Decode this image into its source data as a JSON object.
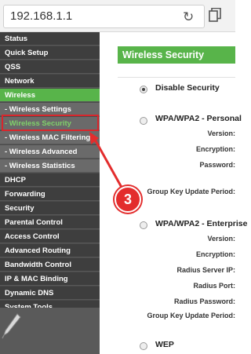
{
  "browser": {
    "url": "192.168.1.1",
    "reload_icon": "reload-icon",
    "tabs_icon": "tabs-icon"
  },
  "sidebar": {
    "items": [
      {
        "label": "Status"
      },
      {
        "label": "Quick Setup"
      },
      {
        "label": "QSS"
      },
      {
        "label": "Network"
      },
      {
        "label": "Wireless"
      },
      {
        "label": "- Wireless Settings"
      },
      {
        "label": "- Wireless Security"
      },
      {
        "label": "- Wireless MAC Filtering"
      },
      {
        "label": "- Wireless Advanced"
      },
      {
        "label": "- Wireless Statistics"
      },
      {
        "label": "DHCP"
      },
      {
        "label": "Forwarding"
      },
      {
        "label": "Security"
      },
      {
        "label": "Parental Control"
      },
      {
        "label": "Access Control"
      },
      {
        "label": "Advanced Routing"
      },
      {
        "label": "Bandwidth Control"
      },
      {
        "label": "IP & MAC Binding"
      },
      {
        "label": "Dynamic DNS"
      },
      {
        "label": "System Tools"
      }
    ]
  },
  "annotation": {
    "step_number": "3",
    "color": "#e32d2d"
  },
  "main": {
    "header": "Wireless Security",
    "options": [
      {
        "label": "Disable Security",
        "selected": true
      },
      {
        "label": "WPA/WPA2 - Personal",
        "selected": false,
        "fields": [
          "Version:",
          "Encryption:",
          "Password:",
          "Group Key Update Period:"
        ]
      },
      {
        "label": "WPA/WPA2 - Enterprise",
        "selected": false,
        "fields": [
          "Version:",
          "Encryption:",
          "Radius Server IP:",
          "Radius Port:",
          "Radius Password:",
          "Group Key Update Period:"
        ]
      },
      {
        "label": "WEP",
        "selected": false
      }
    ]
  },
  "colors": {
    "accent_green": "#58b44a",
    "sidebar_bg": "#3e3e3e",
    "highlight_red": "#d8262c"
  }
}
